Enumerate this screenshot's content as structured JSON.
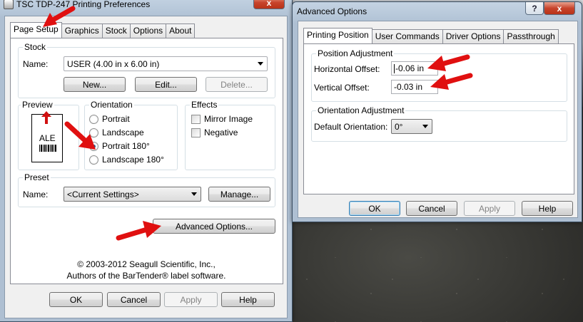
{
  "left_window": {
    "title": "TSC TDP-247 Printing Preferences",
    "tabs": [
      {
        "label": "Page Setup"
      },
      {
        "label": "Graphics"
      },
      {
        "label": "Stock"
      },
      {
        "label": "Options"
      },
      {
        "label": "About"
      }
    ],
    "stock": {
      "group_label": "Stock",
      "name_label": "Name:",
      "name_value": "USER (4.00 in x 6.00 in)",
      "new_button": "New...",
      "edit_button": "Edit...",
      "delete_button": "Delete..."
    },
    "preview": {
      "group_label": "Preview",
      "sample_text": "ALE"
    },
    "orientation": {
      "group_label": "Orientation",
      "options": [
        {
          "label": "Portrait",
          "checked": false
        },
        {
          "label": "Landscape",
          "checked": false
        },
        {
          "label": "Portrait 180°",
          "checked": true
        },
        {
          "label": "Landscape 180°",
          "checked": false
        }
      ]
    },
    "effects": {
      "group_label": "Effects",
      "options": [
        {
          "label": "Mirror Image",
          "checked": false
        },
        {
          "label": "Negative",
          "checked": false
        }
      ]
    },
    "preset": {
      "group_label": "Preset",
      "name_label": "Name:",
      "name_value": "<Current Settings>",
      "manage_button": "Manage..."
    },
    "advanced_options_button": "Advanced Options...",
    "copyright_line1": "© 2003-2012 Seagull Scientific, Inc.,",
    "copyright_line2": "Authors of the BarTender® label software.",
    "ok_button": "OK",
    "cancel_button": "Cancel",
    "apply_button": "Apply",
    "help_button": "Help",
    "close_glyph": "x"
  },
  "right_window": {
    "title": "Advanced Options",
    "help_glyph": "?",
    "close_glyph": "x",
    "tabs": [
      {
        "label": "Printing Position"
      },
      {
        "label": "User Commands"
      },
      {
        "label": "Driver Options"
      },
      {
        "label": "Passthrough"
      }
    ],
    "position_adjustment": {
      "group_label": "Position Adjustment",
      "horizontal_label": "Horizontal Offset:",
      "horizontal_value": "-0.06 in",
      "vertical_label": "Vertical Offset:",
      "vertical_value": "-0.03 in"
    },
    "orientation_adjustment": {
      "group_label": "Orientation Adjustment",
      "default_label": "Default Orientation:",
      "default_value": "0°"
    },
    "ok_button": "OK",
    "cancel_button": "Cancel",
    "apply_button": "Apply",
    "help_button": "Help"
  },
  "colors": {
    "annotation_arrow": "#e01010",
    "title_bar": "#b9cadd",
    "dialog_face": "#f0f0f0"
  },
  "icons": [
    "printer-icon",
    "close-icon",
    "help-icon",
    "chevron-down-icon",
    "arrow-annotation-icon"
  ]
}
